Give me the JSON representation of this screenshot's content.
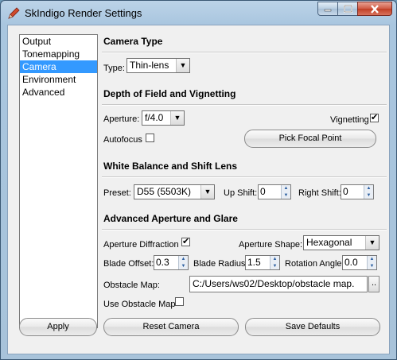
{
  "window": {
    "title": "SkIndigo Render Settings"
  },
  "nav": {
    "items": [
      "Output",
      "Tonemapping",
      "Camera",
      "Environment",
      "Advanced"
    ],
    "selected": "Camera"
  },
  "camera_type": {
    "section_title": "Camera Type",
    "type_label": "Type:",
    "type_value": "Thin-lens"
  },
  "dof": {
    "section_title": "Depth of Field and Vignetting",
    "aperture_label": "Aperture:",
    "aperture_value": "f/4.0",
    "vignetting_label": "Vignetting",
    "vignetting_checked": true,
    "autofocus_label": "Autofocus",
    "autofocus_checked": false,
    "pick_focal_label": "Pick Focal Point"
  },
  "white_balance": {
    "section_title": "White Balance and Shift Lens",
    "preset_label": "Preset:",
    "preset_value": "D55 (5503K)",
    "up_shift_label": "Up Shift:",
    "up_shift_value": "0",
    "right_shift_label": "Right Shift:",
    "right_shift_value": "0"
  },
  "aperture": {
    "section_title": "Advanced Aperture and Glare",
    "diffraction_label": "Aperture Diffraction",
    "diffraction_checked": true,
    "shape_label": "Aperture Shape:",
    "shape_value": "Hexagonal",
    "blade_offset_label": "Blade Offset:",
    "blade_offset_value": "0.3",
    "blade_radius_label": "Blade Radius:",
    "blade_radius_value": "1.5",
    "rotation_label": "Rotation Angle:",
    "rotation_value": "0.0",
    "obstacle_map_label": "Obstacle Map:",
    "obstacle_map_value": "C:/Users/ws02/Desktop/obstacle map.",
    "browse_label": "..",
    "use_obstacle_label": "Use Obstacle Map",
    "use_obstacle_checked": false
  },
  "footer": {
    "apply_label": "Apply",
    "reset_label": "Reset Camera",
    "save_label": "Save Defaults"
  }
}
